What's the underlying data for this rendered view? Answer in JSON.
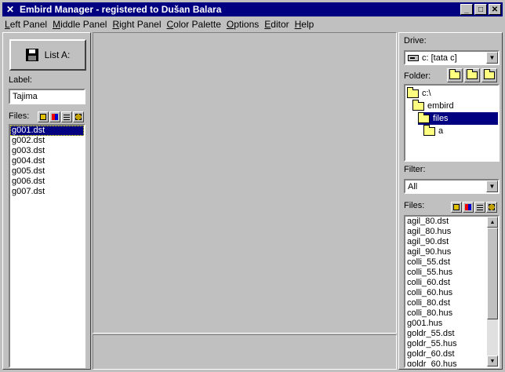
{
  "window": {
    "title": "Embird Manager - registered to Dušan Balara",
    "minimize": "_",
    "maximize": "□",
    "close": "✕"
  },
  "menu": [
    "Left Panel",
    "Middle Panel",
    "Right Panel",
    "Color Palette",
    "Options",
    "Editor",
    "Help"
  ],
  "left_panel": {
    "list_button_label": "List A:",
    "label_caption": "Label:",
    "label_value": "Tajima",
    "files_caption": "Files:",
    "files": [
      "g001.dst",
      "g002.dst",
      "g003.dst",
      "g004.dst",
      "g005.dst",
      "g006.dst",
      "g007.dst"
    ],
    "selected_index": 0
  },
  "right_panel": {
    "drive_caption": "Drive:",
    "drive_value": "c: [tata c]",
    "folder_caption": "Folder:",
    "folders": [
      {
        "name": "c:\\",
        "level": 0,
        "selected": false
      },
      {
        "name": "embird",
        "level": 1,
        "selected": false
      },
      {
        "name": "files",
        "level": 2,
        "selected": true
      },
      {
        "name": "a",
        "level": 3,
        "selected": false
      }
    ],
    "filter_caption": "Filter:",
    "filter_value": "All",
    "files_caption": "Files:",
    "files": [
      "agil_80.dst",
      "agil_80.hus",
      "agil_90.dst",
      "agil_90.hus",
      "colli_55.dst",
      "colli_55.hus",
      "colli_60.dst",
      "colli_60.hus",
      "colli_80.dst",
      "colli_80.hus",
      "g001.hus",
      "goldr_55.dst",
      "goldr_55.hus",
      "goldr_60.dst",
      "goldr_60.hus"
    ]
  },
  "colors": {
    "title_bg": "#000080",
    "face": "#c0c0c0",
    "selection": "#000080"
  }
}
